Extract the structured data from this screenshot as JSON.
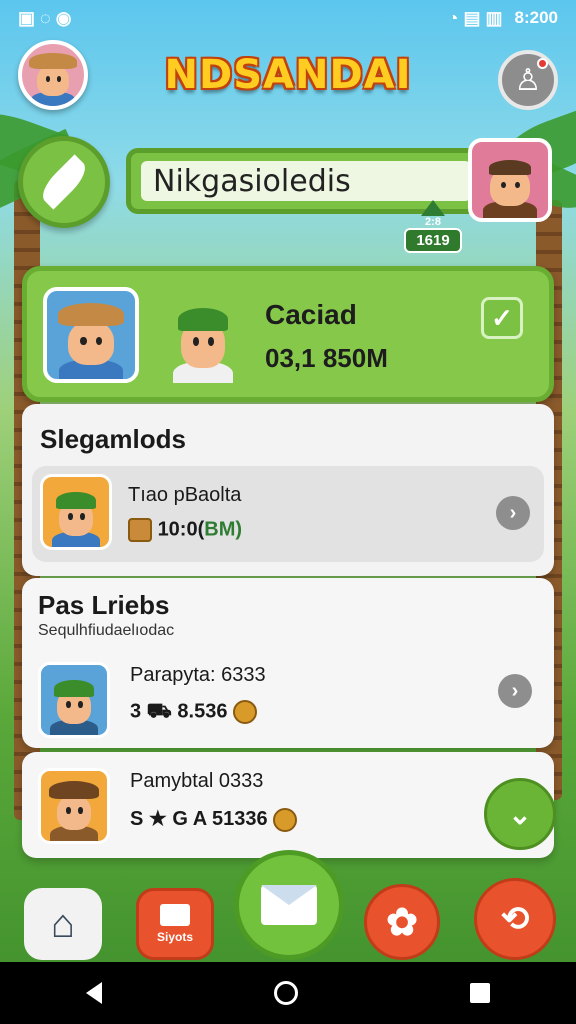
{
  "status_bar": {
    "left_icons": "▣ ◌ ◉",
    "right_icons": "◔ ▤ ▥",
    "time": "8:200"
  },
  "app_title": "NDSANDAI",
  "name_box": {
    "name": "Nikgasioledis"
  },
  "badge": {
    "top": "2:8",
    "value": "1619"
  },
  "hero": {
    "label": "Caciad",
    "value": "03,1 850M",
    "check": "✓"
  },
  "section1": {
    "title": "Slegamlods",
    "item": {
      "line1": "Tıao pBaolta",
      "line2_prefix": "10:0(",
      "line2_green": "BM)"
    }
  },
  "section2": {
    "title": "Pas Lriebs",
    "subtitle": "Sequlhfiudaelıodac",
    "items": [
      {
        "line1": "Parapyta: 6333",
        "line2": "3 ⛟ 8.536"
      },
      {
        "line1": "Pamybtal 0333",
        "line2": "S ★ G A 51336"
      }
    ]
  },
  "nav": {
    "shop_label": "Siyots"
  },
  "icons": {
    "home": "⌂",
    "gear": "✿",
    "map": "⟲",
    "chevron": "›",
    "person": "♙",
    "fab": "⌄"
  },
  "colors": {
    "green": "#7bc143",
    "orange": "#e8522c",
    "title_yellow": "#ffcc22"
  }
}
